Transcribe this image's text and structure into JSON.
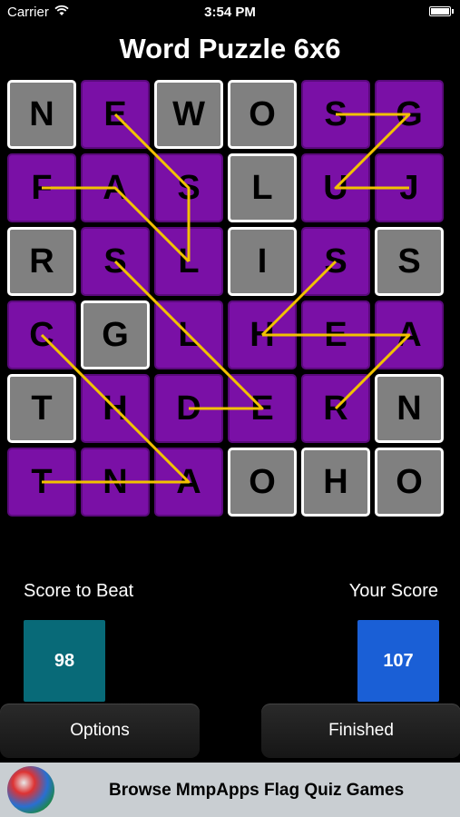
{
  "status": {
    "carrier": "Carrier",
    "time": "3:54 PM"
  },
  "title": "Word Puzzle 6x6",
  "grid": [
    [
      {
        "l": "N",
        "g": true
      },
      {
        "l": "E",
        "g": false
      },
      {
        "l": "W",
        "g": true
      },
      {
        "l": "O",
        "g": true
      },
      {
        "l": "S",
        "g": false
      },
      {
        "l": "G",
        "g": false
      }
    ],
    [
      {
        "l": "F",
        "g": false
      },
      {
        "l": "A",
        "g": false
      },
      {
        "l": "S",
        "g": false
      },
      {
        "l": "L",
        "g": true
      },
      {
        "l": "U",
        "g": false
      },
      {
        "l": "J",
        "g": false
      }
    ],
    [
      {
        "l": "R",
        "g": true
      },
      {
        "l": "S",
        "g": false
      },
      {
        "l": "L",
        "g": false
      },
      {
        "l": "I",
        "g": true
      },
      {
        "l": "S",
        "g": false
      },
      {
        "l": "S",
        "g": true
      }
    ],
    [
      {
        "l": "C",
        "g": false
      },
      {
        "l": "G",
        "g": true
      },
      {
        "l": "L",
        "g": false
      },
      {
        "l": "H",
        "g": false
      },
      {
        "l": "E",
        "g": false
      },
      {
        "l": "A",
        "g": false
      }
    ],
    [
      {
        "l": "T",
        "g": true
      },
      {
        "l": "H",
        "g": false
      },
      {
        "l": "D",
        "g": false
      },
      {
        "l": "E",
        "g": false
      },
      {
        "l": "R",
        "g": false
      },
      {
        "l": "N",
        "g": true
      }
    ],
    [
      {
        "l": "T",
        "g": false
      },
      {
        "l": "N",
        "g": false
      },
      {
        "l": "A",
        "g": false
      },
      {
        "l": "O",
        "g": true
      },
      {
        "l": "H",
        "g": true
      },
      {
        "l": "O",
        "g": true
      }
    ]
  ],
  "paths": [
    [
      [
        4,
        0
      ],
      [
        5,
        0
      ],
      [
        4,
        1
      ],
      [
        5,
        1
      ]
    ],
    [
      [
        1,
        0
      ],
      [
        2,
        1
      ],
      [
        2,
        2
      ]
    ],
    [
      [
        0,
        1
      ],
      [
        1,
        1
      ],
      [
        2,
        2
      ]
    ],
    [
      [
        1,
        2
      ],
      [
        3,
        4
      ],
      [
        2,
        4
      ]
    ],
    [
      [
        0,
        3
      ],
      [
        2,
        5
      ],
      [
        1,
        5
      ],
      [
        0,
        5
      ]
    ],
    [
      [
        3,
        3
      ],
      [
        4,
        3
      ],
      [
        5,
        3
      ],
      [
        4,
        4
      ]
    ],
    [
      [
        4,
        2
      ],
      [
        3,
        3
      ]
    ]
  ],
  "colors": {
    "purple": "#7a10a6",
    "gray": "#808080",
    "line": "#f2c200",
    "score_beat": "#086a78",
    "your_score": "#1a5fd6"
  },
  "scores": {
    "beat_label": "Score to Beat",
    "beat_value": "98",
    "your_label": "Your Score",
    "your_value": "107"
  },
  "buttons": {
    "options": "Options",
    "finished": "Finished"
  },
  "ad": {
    "text": "Browse MmpApps Flag Quiz Games",
    "icon": "globe-flags-icon"
  }
}
